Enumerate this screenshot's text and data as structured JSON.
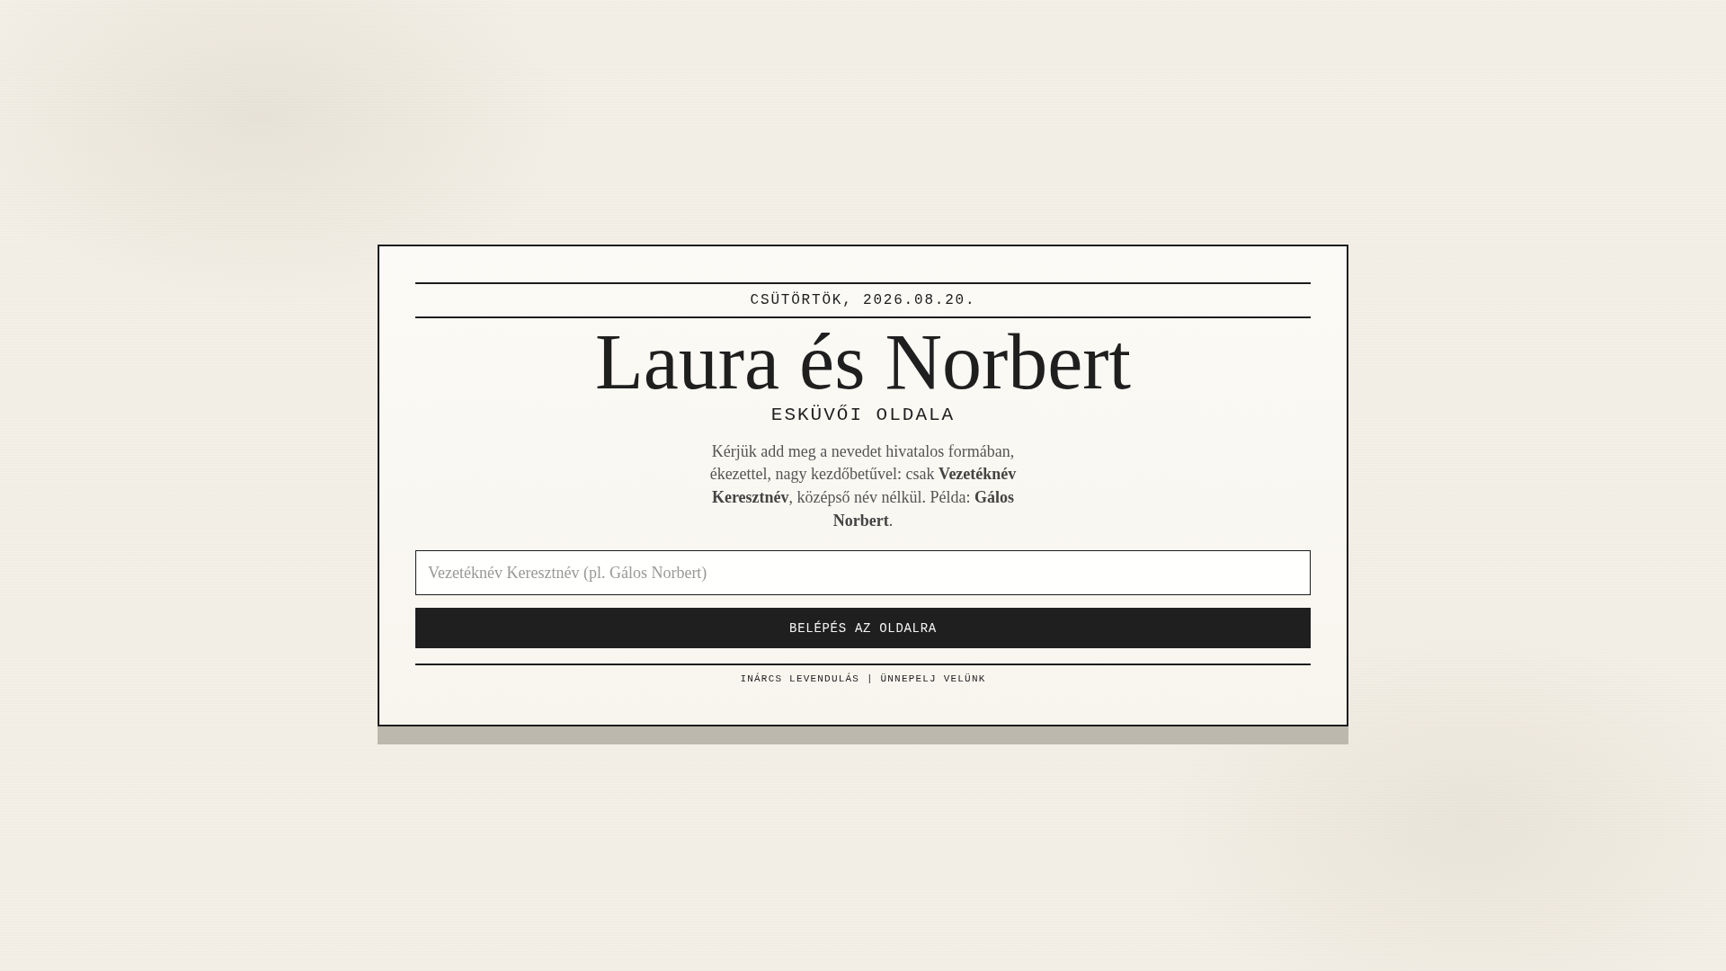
{
  "card": {
    "date": "CSÜTÖRTÖK, 2026.08.20.",
    "title": "Laura és Norbert",
    "subtitle": "ESKÜVŐI OLDALA",
    "instructions": "Kérjük add meg a nevedet hivatalos formában, ékezettel, nagy kezdőbetűvel: csak **Vezetéknév Keresztnév**, középső név nélkül. Példa: **Gálos Norbert**.",
    "name_field": {
      "placeholder": "Vezetéknév Keresztnév (pl. Gálos Norbert)"
    },
    "submit_button": "BELÉPÉS AZ OLDALRA",
    "footer": "INÁRCS LEVENDULÁS | ÜNNEPELJ VELÜNK"
  }
}
